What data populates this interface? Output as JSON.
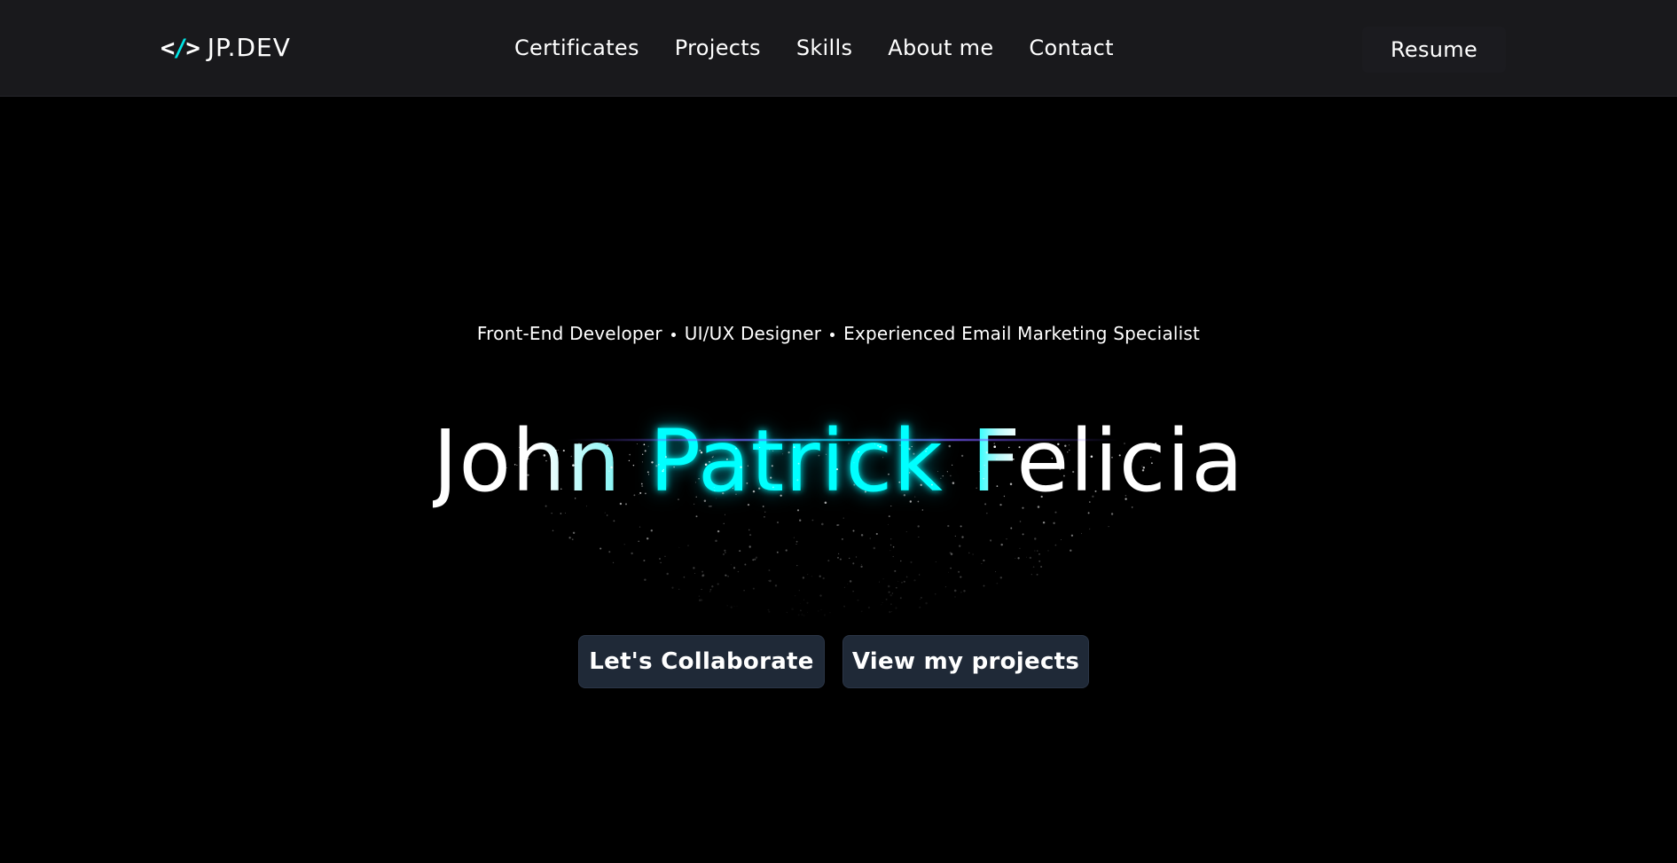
{
  "header": {
    "logo_icon": "</>",
    "logo_text": "JP.DEV",
    "nav": [
      {
        "label": "Certificates"
      },
      {
        "label": "Projects"
      },
      {
        "label": "Skills"
      },
      {
        "label": "About me"
      },
      {
        "label": "Contact"
      }
    ],
    "resume_label": "Resume"
  },
  "hero": {
    "roles": [
      "Front-End Developer",
      "UI/UX Designer",
      "Experienced Email Marketing Specialist"
    ],
    "name_first": "John",
    "name_middle": "Patrick",
    "name_last": "Felicia",
    "primary_cta": "Let's Collaborate",
    "secondary_cta": "View my projects"
  },
  "colors": {
    "background": "#000000",
    "navbar": "#19191c",
    "accent": "#00ffff",
    "button": "#1f2937"
  },
  "icons": {
    "logo": "code-brackets-icon",
    "separator": "dot-icon"
  }
}
